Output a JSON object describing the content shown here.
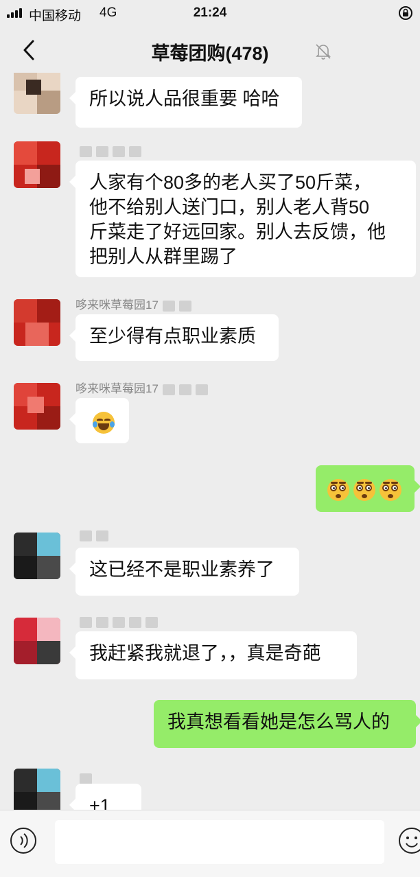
{
  "status_bar": {
    "carrier": "中国移动",
    "network": "4G",
    "time": "21:24",
    "icons": [
      "signal-icon",
      "orientation-lock-icon"
    ]
  },
  "nav": {
    "title": "草莓团购(478)",
    "icons": [
      "back-arrow-icon",
      "mute-bell-icon"
    ]
  },
  "messages": [
    {
      "side": "left",
      "sender": "",
      "text": "所以说人品很重要 哈哈"
    },
    {
      "side": "left",
      "sender": "",
      "lines": [
        "人家有个80多的老人买了50斤菜，",
        "他不给别人送门口，别人老人背50",
        "斤菜走了好远回家。别人去反馈，他",
        "把别人从群里踢了"
      ]
    },
    {
      "side": "left",
      "sender": "哆来咪草莓园17",
      "text": "至少得有点职业素质"
    },
    {
      "side": "left",
      "sender": "哆来咪草莓园17",
      "emoji": "laugh-cry-emoji"
    },
    {
      "side": "right",
      "emoji": "shocked-face-emoji",
      "count": 3
    },
    {
      "side": "left",
      "sender": "",
      "text": "这已经不是职业素养了"
    },
    {
      "side": "left",
      "sender": "",
      "text": "我赶紧我就退了，，真是奇葩"
    },
    {
      "side": "right",
      "text": "我真想看看她是怎么骂人的"
    },
    {
      "side": "left",
      "sender": "",
      "text": "+1"
    }
  ],
  "input_bar": {
    "icons": [
      "voice-icon",
      "emoji-icon"
    ],
    "placeholder": ""
  },
  "colors": {
    "background": "#ededed",
    "right_bubble": "#95ec69",
    "left_bubble": "#ffffff"
  }
}
